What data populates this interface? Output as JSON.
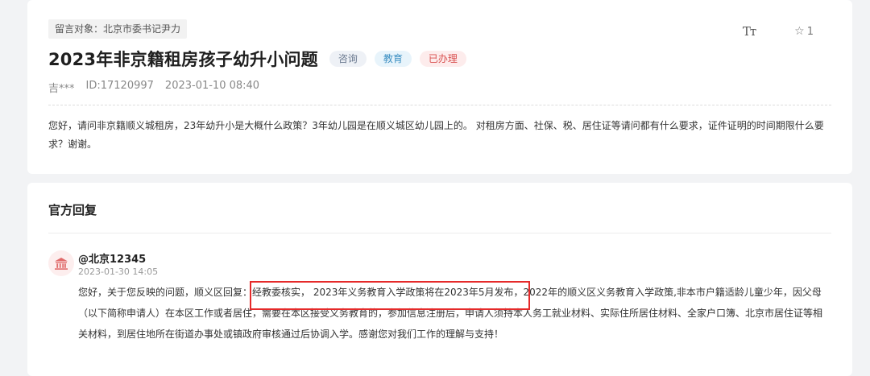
{
  "question": {
    "target_label": "留言对象：北京市委书记尹力",
    "title": "2023年非京籍租房孩子幼升小问题",
    "tags": [
      "咨询",
      "教育",
      "已办理"
    ],
    "font_size_icon": "Tт",
    "favorite_count": "1",
    "author": "吉***",
    "id": "ID:17120997",
    "time": "2023-01-10 08:40",
    "content": "您好，请问非京籍顺义城租房，23年幼升小是大概什么政策？3年幼儿园是在顺义城区幼儿园上的。 对租房方面、社保、税、居住证等请问都有什么要求，证件证明的时间期限什么要求？谢谢。"
  },
  "reply": {
    "section_title": "官方回复",
    "name": "@北京12345",
    "time": "2023-01-30 14:05",
    "content": "您好，关于您反映的问题，顺义区回复：经教委核实， 2023年义务教育入学政策将在2023年5月发布，2022年的顺义区义务教育入学政策,非本市户籍适龄儿童少年，因父母（以下简称申请人）在本区工作或者居住，需要在本区接受义务教育的，参加信息注册后，申请人须持本人务工就业材料、实际住所居住材料、全家户口簿、北京市居住证等相关材料，到居住地所在街道办事处或镇政府审核通过后协调入学。感谢您对我们工作的理解与支持！"
  },
  "icons": {
    "star": "☆",
    "avatar": "government-building-icon"
  },
  "colors": {
    "done_tag": "#d9504f",
    "edu_tag": "#3c8fc2",
    "highlight_border": "#e52a2a"
  }
}
